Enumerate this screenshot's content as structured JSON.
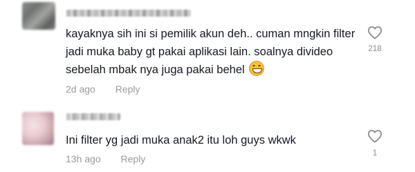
{
  "comments": [
    {
      "text": "kayaknya sih ini si pemilik akun deh.. cuman mngkin filter jadi muka baby gt pakai aplikasi lain. soalnya divideo sebelah mbak nya juga pakai behel",
      "emoji": "grinning-face-emoji",
      "time": "2d ago",
      "reply_label": "Reply",
      "likes": "218"
    },
    {
      "text": "Ini filter yg jadi muka anak2 itu loh guys wkwk",
      "time": "13h ago",
      "reply_label": "Reply",
      "likes": "1"
    }
  ],
  "icons": {
    "like": "heart-outline-icon"
  }
}
